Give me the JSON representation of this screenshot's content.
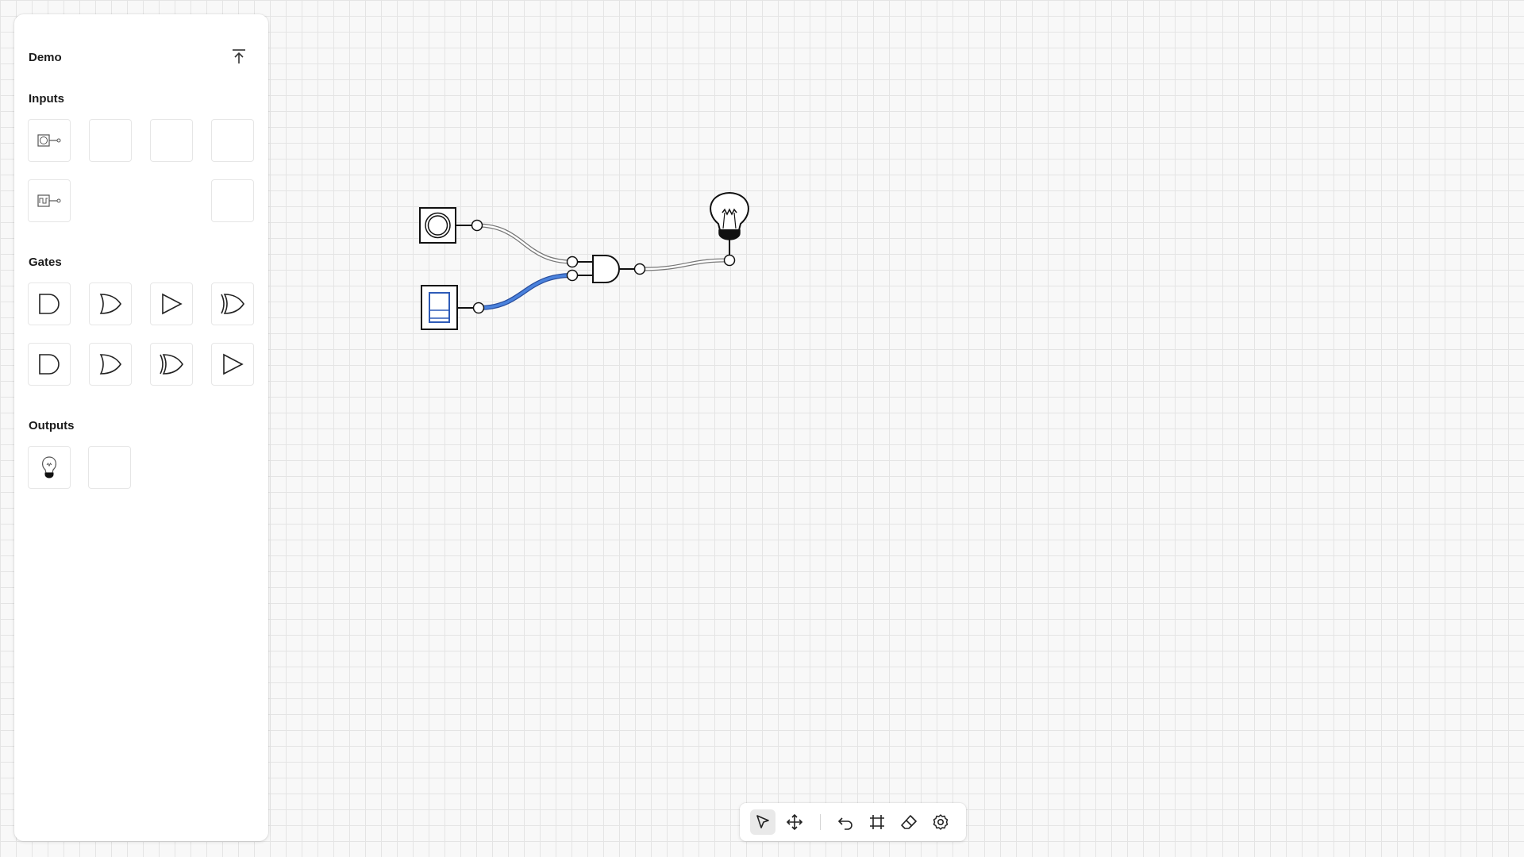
{
  "panel": {
    "title": "Demo",
    "collapse_icon": "collapse-up-icon",
    "sections": {
      "inputs": "Inputs",
      "gates": "Gates",
      "outputs": "Outputs"
    },
    "input_tiles": [
      {
        "icon": "push-button-icon"
      },
      {
        "icon": ""
      },
      {
        "icon": ""
      },
      {
        "icon": ""
      },
      {
        "icon": "clock-icon"
      },
      {
        "icon": ""
      }
    ],
    "gate_tiles": [
      {
        "icon": "and-gate-icon"
      },
      {
        "icon": "or-gate-icon"
      },
      {
        "icon": "buffer-gate-icon"
      },
      {
        "icon": "xor-gate-icon"
      },
      {
        "icon": "nand-gate-icon"
      },
      {
        "icon": "nor-gate-icon"
      },
      {
        "icon": "xnor-gate-icon"
      },
      {
        "icon": "not-gate-icon"
      }
    ],
    "output_tiles": [
      {
        "icon": "light-bulb-icon"
      },
      {
        "icon": ""
      }
    ]
  },
  "toolbar": {
    "tools": [
      {
        "icon": "select-cursor-icon",
        "active": true
      },
      {
        "icon": "move-icon",
        "active": false
      },
      {
        "icon": "undo-icon",
        "active": false
      },
      {
        "icon": "frame-icon",
        "active": false
      },
      {
        "icon": "eraser-icon",
        "active": false
      },
      {
        "icon": "settings-icon",
        "active": false
      }
    ]
  },
  "circuit": {
    "components": [
      "push-button",
      "toggle-switch",
      "and-gate",
      "light-bulb"
    ],
    "wire_active_color": "#3b6fd0",
    "wire_inactive_color": "#777777"
  }
}
